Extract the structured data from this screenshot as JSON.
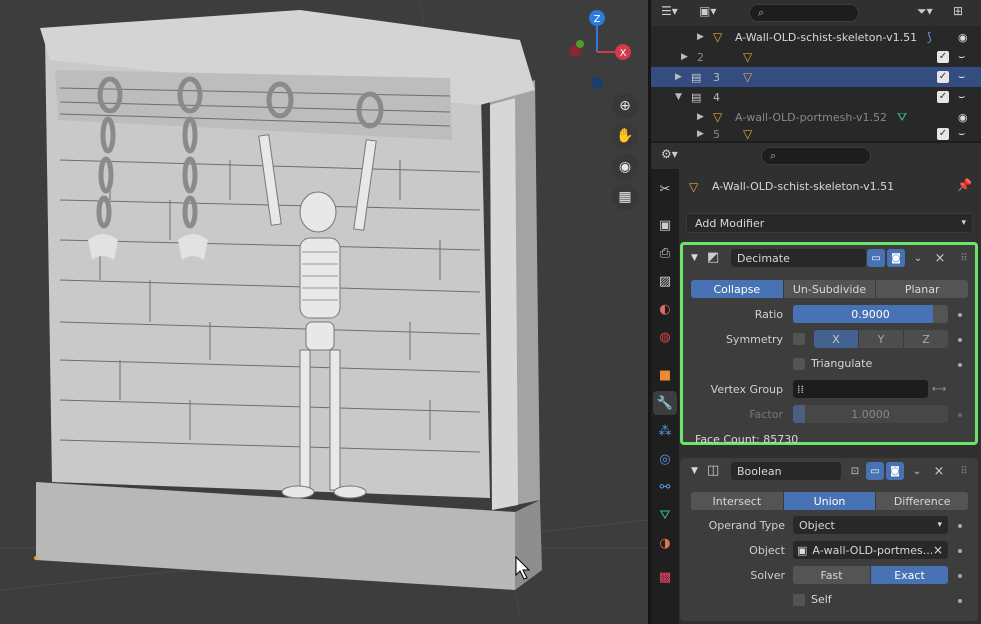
{
  "viewport": {
    "gizmo": {
      "z_label": "Z",
      "x_label": "X"
    },
    "nav_icons": [
      "zoom-icon",
      "hand-pan-icon",
      "camera-icon",
      "grid-icon"
    ]
  },
  "outliner": {
    "search_placeholder": "",
    "rows": [
      {
        "label": "A-Wall-OLD-schist-skeleton-v1.51"
      },
      {
        "label": "2"
      },
      {
        "label": "3"
      },
      {
        "label": "4"
      },
      {
        "label": "A-wall-OLD-portmesh-v1.52"
      },
      {
        "label": "5"
      }
    ]
  },
  "properties": {
    "search_placeholder": "",
    "object_name": "A-Wall-OLD-schist-skeleton-v1.51",
    "add_modifier": "Add Modifier",
    "decimate": {
      "name": "Decimate",
      "modes": [
        "Collapse",
        "Un-Subdivide",
        "Planar"
      ],
      "active_mode": "Collapse",
      "ratio_label": "Ratio",
      "ratio_value": "0.9000",
      "ratio_fraction": 0.9,
      "symmetry_label": "Symmetry",
      "axes": [
        "X",
        "Y",
        "Z"
      ],
      "triangulate_label": "Triangulate",
      "vertex_group_label": "Vertex Group",
      "factor_label": "Factor",
      "factor_value": "1.0000",
      "face_count": "Face Count: 85730"
    },
    "boolean": {
      "name": "Boolean",
      "ops": [
        "Intersect",
        "Union",
        "Difference"
      ],
      "active_op": "Union",
      "operand_label": "Operand Type",
      "operand_value": "Object",
      "object_label": "Object",
      "object_value": "A-wall-OLD-portmes...",
      "solver_label": "Solver",
      "solver_fast": "Fast",
      "solver_exact": "Exact",
      "self_label": "Self"
    }
  },
  "colors": {
    "accent": "#4772b3",
    "highlight": "#6be46b",
    "selection": "#334d80"
  }
}
